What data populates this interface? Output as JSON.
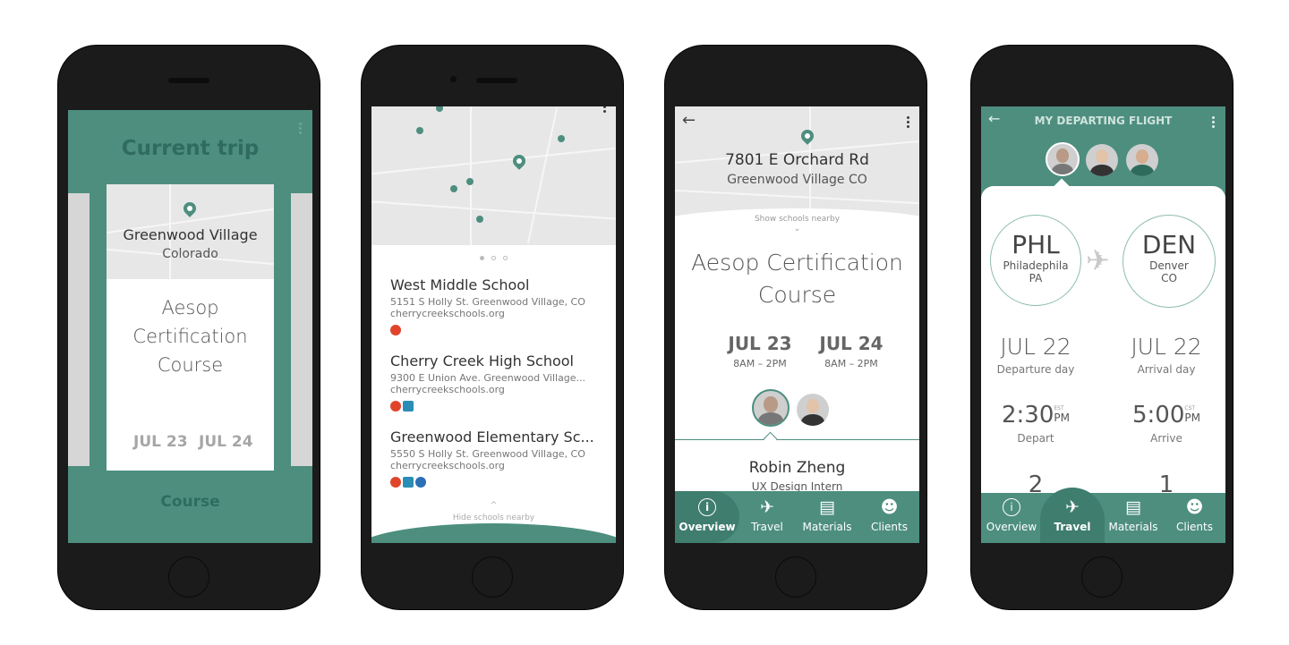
{
  "colors": {
    "teal": "#4d8e7f",
    "dark": "#3a3a3a",
    "gray_text": "#7a7a7a"
  },
  "screen1": {
    "title": "Current trip",
    "card": {
      "location_title": "Greenwood Village",
      "location_sub": "Colorado",
      "course_name": "Aesop Certification Course",
      "date_start": "JUL 23",
      "date_end": "JUL 24"
    },
    "bottom_label": "Course"
  },
  "screen2": {
    "schools": [
      {
        "name": "West Middle School",
        "address": "5151 S Holly St. Greenwood Village, CO",
        "website": "cherrycreekschools.org"
      },
      {
        "name": "Cherry Creek High School",
        "address": "9300 E  Union Ave. Greenwood Village...",
        "website": "cherrycreekschools.org"
      },
      {
        "name": "Greenwood Elementary Sc...",
        "address": "5550 S Holly St. Greenwood Village, CO",
        "website": "cherrycreekschools.org"
      }
    ],
    "hide_label": "Hide schools nearby"
  },
  "screen3": {
    "address": "7801 E Orchard Rd",
    "city": "Greenwood Village CO",
    "show_label": "Show schools nearby",
    "course_line1": "Aesop Certification",
    "course_line2": "Course",
    "date1": "JUL 23",
    "time1": "8AM – 2PM",
    "date2": "JUL 24",
    "time2": "8AM – 2PM",
    "person_name": "Robin Zheng",
    "person_title": "UX Design Intern",
    "nav": [
      {
        "label": "Overview",
        "icon": "info-icon"
      },
      {
        "label": "Travel",
        "icon": "plane-icon"
      },
      {
        "label": "Materials",
        "icon": "book-icon"
      },
      {
        "label": "Clients",
        "icon": "users-icon"
      }
    ]
  },
  "screen4": {
    "title": "MY DEPARTING FLIGHT",
    "from": {
      "code": "PHL",
      "city": "Philadephila",
      "state": "PA"
    },
    "to": {
      "code": "DEN",
      "city": "Denver",
      "state": "CO"
    },
    "dep_date": "JUL 22",
    "dep_label": "Departure day",
    "arr_date": "JUL 22",
    "arr_label": "Arrival day",
    "dep_time": "2:30",
    "dep_tz": "EST",
    "dep_ampm": "PM",
    "dep_time_label": "Depart",
    "arr_time": "5:00",
    "arr_tz": "CST",
    "arr_ampm": "PM",
    "arr_time_label": "Arrive",
    "num_left": "2",
    "num_right": "1",
    "nav": [
      {
        "label": "Overview",
        "icon": "info-icon"
      },
      {
        "label": "Travel",
        "icon": "plane-icon"
      },
      {
        "label": "Materials",
        "icon": "book-icon"
      },
      {
        "label": "Clients",
        "icon": "users-icon"
      }
    ]
  }
}
